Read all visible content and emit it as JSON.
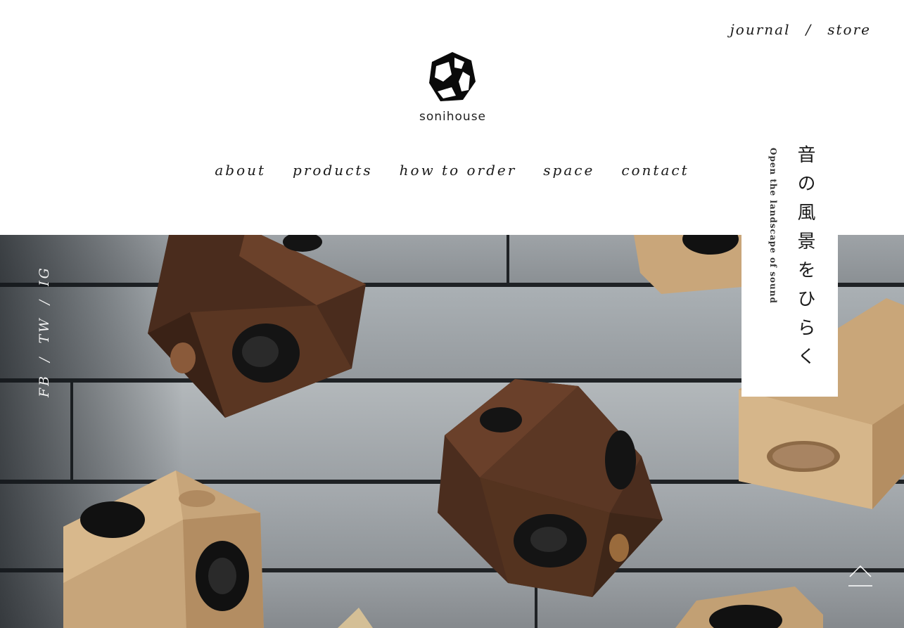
{
  "header": {
    "util_links": [
      {
        "label": "journal"
      },
      {
        "label": "store"
      }
    ],
    "util_separator": "/",
    "brand": {
      "name": "sonihouse"
    }
  },
  "nav": {
    "items": [
      {
        "label": "about"
      },
      {
        "label": "products"
      },
      {
        "label": "how to order"
      },
      {
        "label": "space"
      },
      {
        "label": "contact"
      }
    ]
  },
  "social": {
    "items": [
      {
        "label": "FB"
      },
      {
        "label": "TW"
      },
      {
        "label": "IG"
      }
    ],
    "separator": "/"
  },
  "tagline": {
    "japanese": "音の風景をひらく",
    "english": "Open the landscape of sound"
  },
  "icons": {
    "logo": "dodecahedron-logo-icon",
    "back_to_top": "chevron-up-icon"
  },
  "colors": {
    "text": "#1a1a1a",
    "background": "#ffffff",
    "hero_overlay_text": "#f2f2f2"
  }
}
